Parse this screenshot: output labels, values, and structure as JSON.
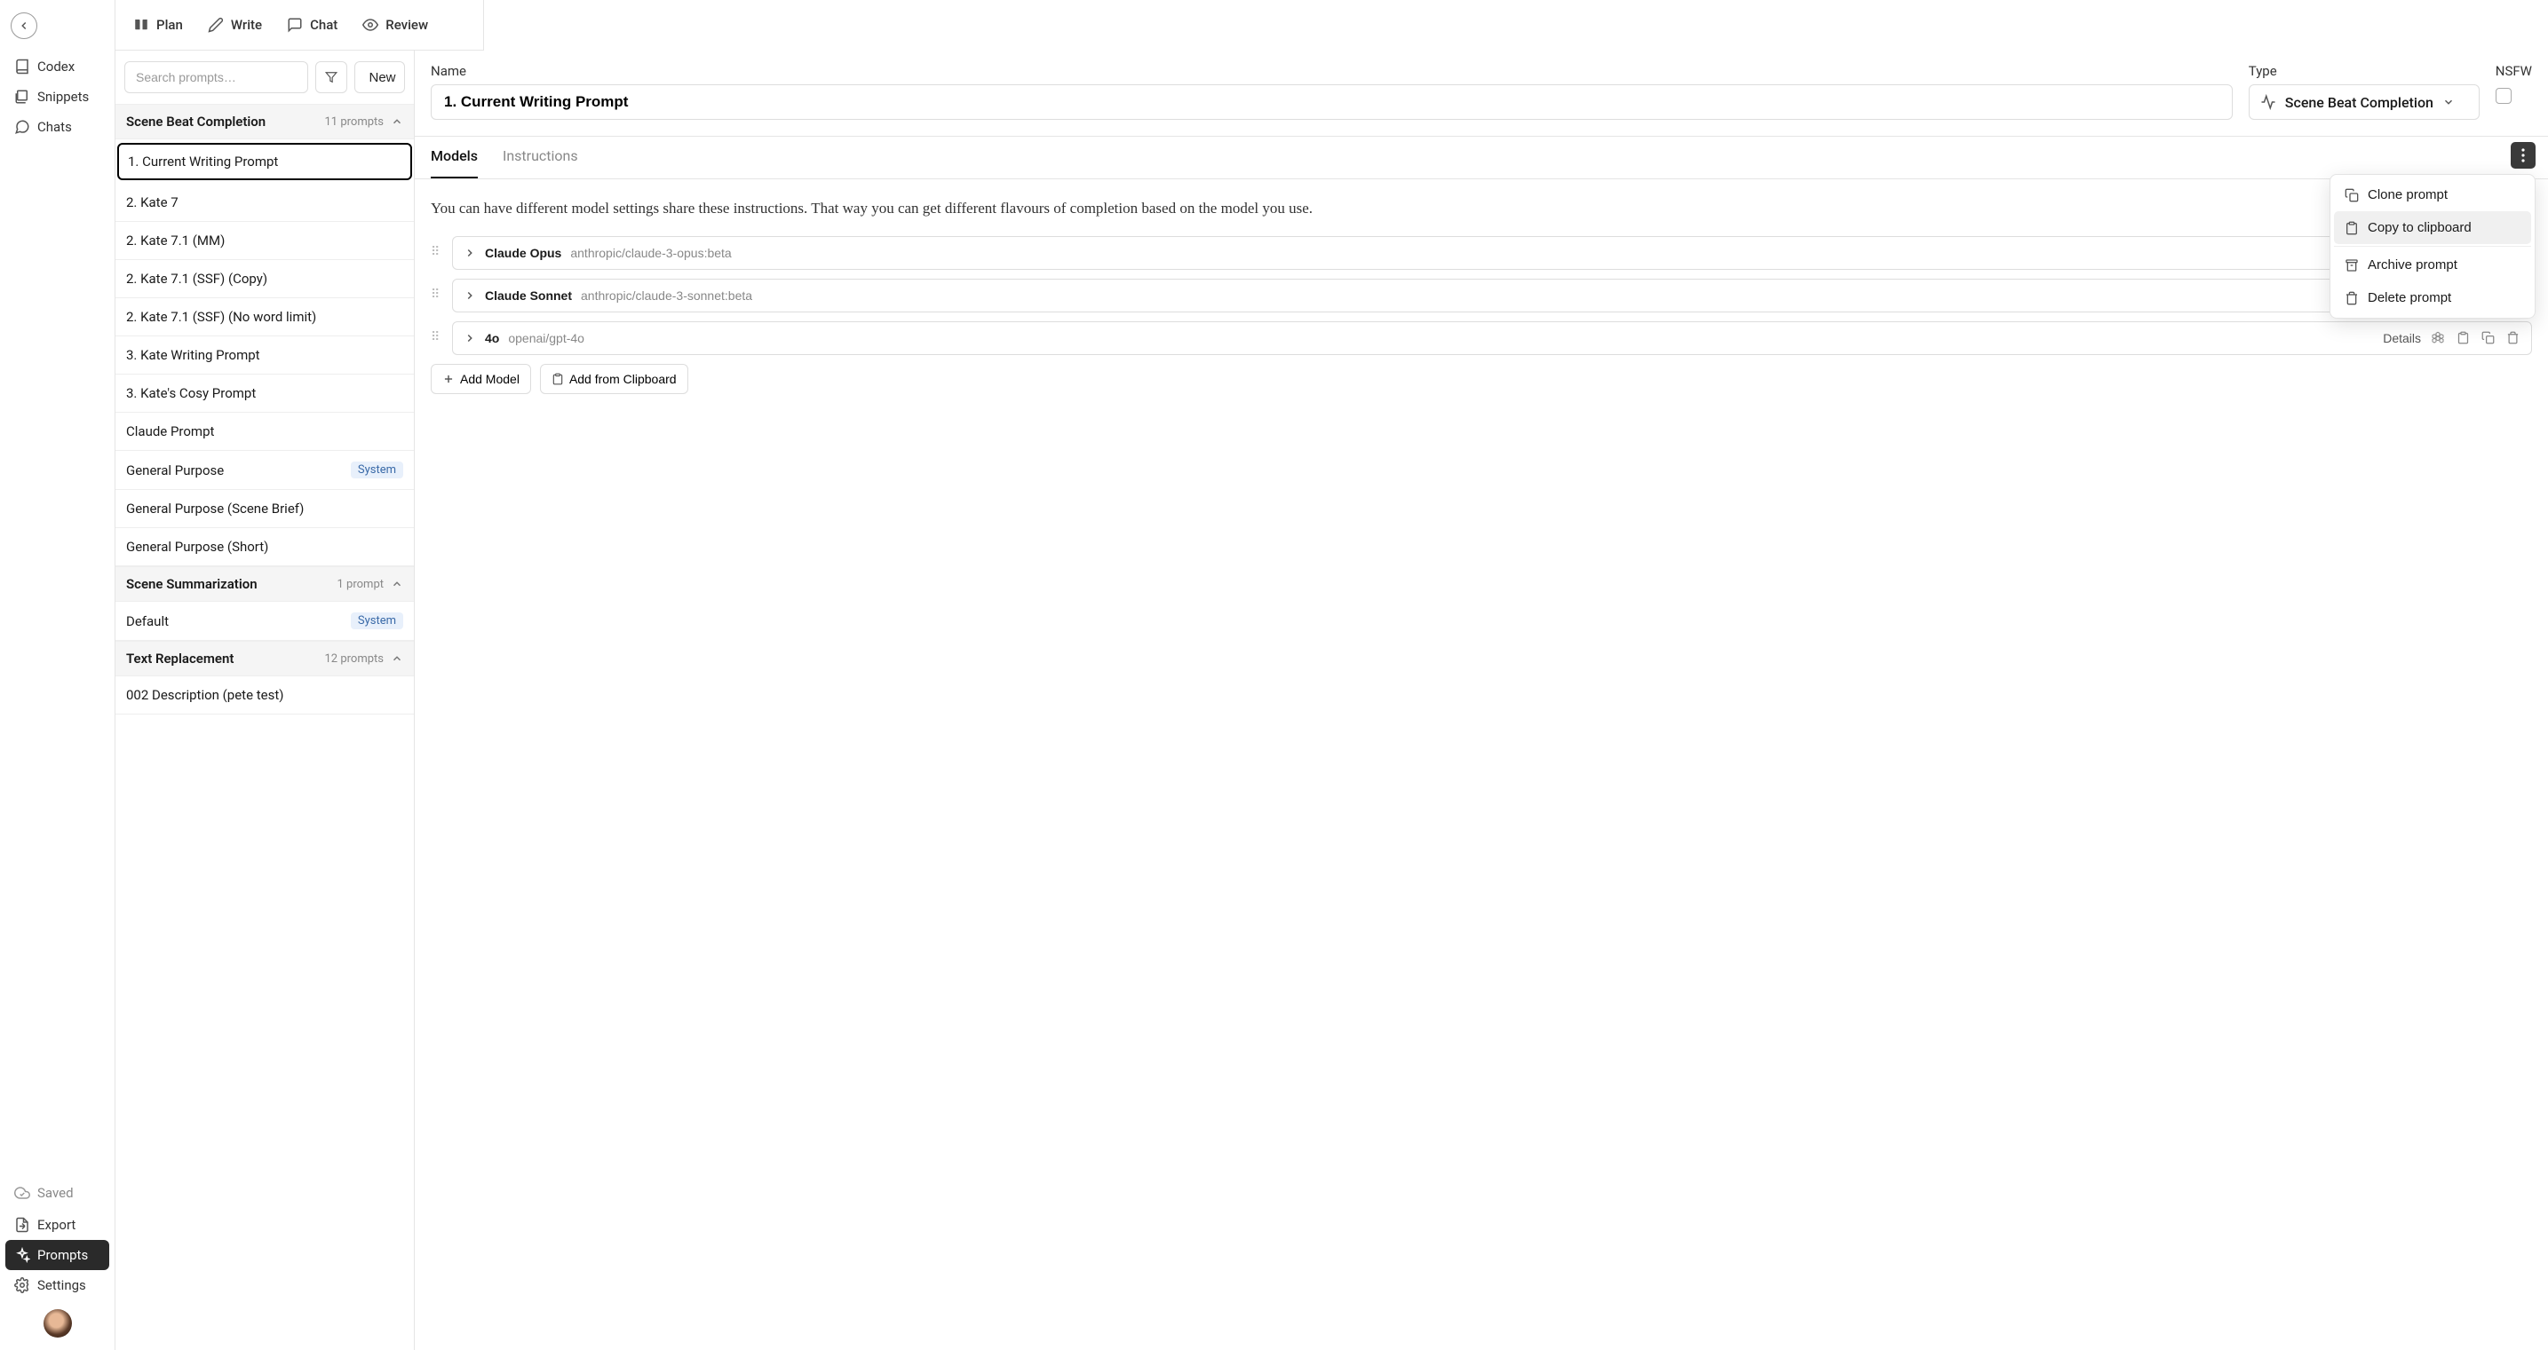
{
  "topbar": {
    "tabs": [
      "Plan",
      "Write",
      "Chat",
      "Review"
    ]
  },
  "leftnav": {
    "items": [
      {
        "label": "Codex"
      },
      {
        "label": "Snippets"
      },
      {
        "label": "Chats"
      }
    ],
    "saved_label": "Saved",
    "bottom": [
      {
        "label": "Export"
      },
      {
        "label": "Prompts"
      },
      {
        "label": "Settings"
      }
    ]
  },
  "middle": {
    "search_placeholder": "Search prompts…",
    "new_label": "New",
    "groups": [
      {
        "title": "Scene Beat Completion",
        "count": "11 prompts",
        "items": [
          {
            "label": "1. Current Writing Prompt",
            "selected": true
          },
          {
            "label": "2. Kate 7"
          },
          {
            "label": "2. Kate 7.1 (MM)"
          },
          {
            "label": "2. Kate 7.1 (SSF) (Copy)"
          },
          {
            "label": "2. Kate 7.1 (SSF) (No word limit)"
          },
          {
            "label": "3. Kate Writing Prompt"
          },
          {
            "label": "3. Kate's Cosy Prompt"
          },
          {
            "label": "Claude Prompt"
          },
          {
            "label": "General Purpose",
            "badge": "System"
          },
          {
            "label": "General Purpose (Scene Brief)"
          },
          {
            "label": "General Purpose (Short)"
          }
        ]
      },
      {
        "title": "Scene Summarization",
        "count": "1 prompt",
        "items": [
          {
            "label": "Default",
            "badge": "System"
          }
        ]
      },
      {
        "title": "Text Replacement",
        "count": "12 prompts",
        "items": [
          {
            "label": "002 Description (pete test)"
          }
        ]
      }
    ]
  },
  "detail": {
    "name_label": "Name",
    "type_label": "Type",
    "nsfw_label": "NSFW",
    "name_value": "1. Current Writing Prompt",
    "type_value": "Scene Beat Completion",
    "subtabs": [
      "Models",
      "Instructions"
    ],
    "active_subtab": 0,
    "help_text": "You can have different model settings share these instructions. That way you can get different flavours of completion based on the model you use.",
    "details_label": "Details",
    "models": [
      {
        "name": "Claude Opus",
        "id": "anthropic/claude-3-opus:beta",
        "provider": "anthropic"
      },
      {
        "name": "Claude Sonnet",
        "id": "anthropic/claude-3-sonnet:beta",
        "provider": "anthropic"
      },
      {
        "name": "4o",
        "id": "openai/gpt-4o",
        "provider": "openai"
      }
    ],
    "add_model_label": "Add Model",
    "add_clipboard_label": "Add from Clipboard"
  },
  "menu": {
    "items": [
      {
        "label": "Clone prompt",
        "icon": "copy"
      },
      {
        "label": "Copy to clipboard",
        "icon": "clipboard",
        "hover": true
      },
      {
        "label": "Archive prompt",
        "icon": "archive",
        "sep_before": true
      },
      {
        "label": "Delete prompt",
        "icon": "trash"
      }
    ]
  }
}
